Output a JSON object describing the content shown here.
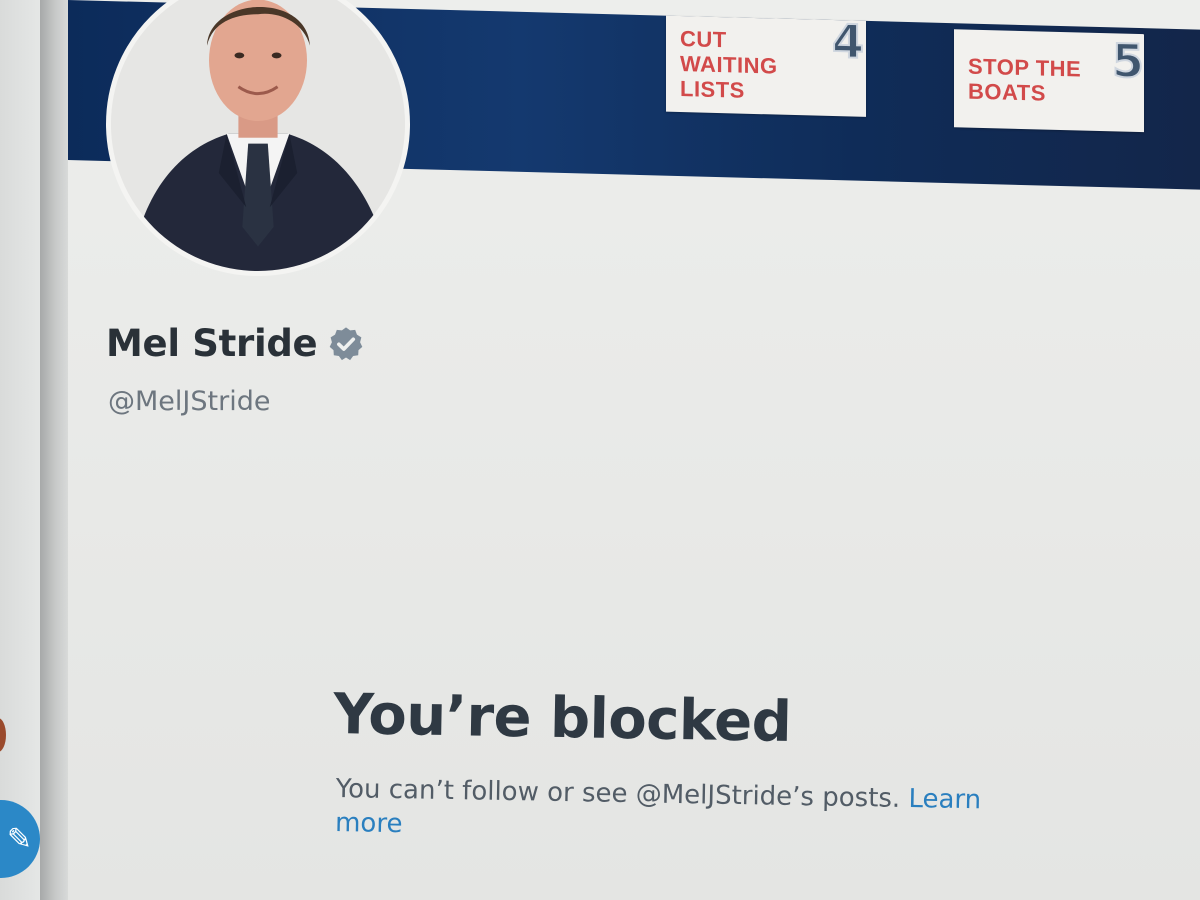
{
  "banner": {
    "cards": [
      {
        "text": "CUT\nWAITING\nLISTS",
        "number": "4"
      },
      {
        "text": "STOP THE\nBOATS",
        "number": "5"
      }
    ],
    "background_color": "#0f2c58",
    "card_text_color": "#d24a4a"
  },
  "profile": {
    "display_name": "Mel Stride",
    "handle": "@MelJStride",
    "verified": true,
    "verified_color": "#7e8c99",
    "avatar_icon": "profile-photo"
  },
  "blocked": {
    "title": "You’re blocked",
    "message": "You can’t follow or see @MelJStride’s posts.",
    "link_label_first": "Learn",
    "link_label_second": "more",
    "link_color": "#2a7fbf"
  },
  "sidebar": {
    "compose_icon": "compose-icon",
    "accent_color": "#2b88c7"
  }
}
